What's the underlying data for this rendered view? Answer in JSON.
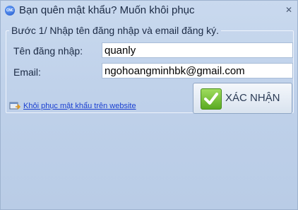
{
  "window": {
    "title": "Bạn quên mật khẩu? Muốn khôi phục",
    "icon": "app-logo-icon",
    "icon_text": "CNC",
    "close_glyph": "✕"
  },
  "group": {
    "legend": "Bước 1/ Nhập tên đăng nhập và email đăng ký."
  },
  "form": {
    "username_label": "Tên đăng nhập:",
    "username_value": "quanly",
    "email_label": "Email:",
    "email_value": "ngohoangminhbk@gmail.com"
  },
  "confirm_button": {
    "label": "XÁC NHẬN",
    "icon": "checkmark-icon"
  },
  "link": {
    "label": "Khôi phục mật khẩu trên website",
    "icon": "web-link-icon"
  },
  "colors": {
    "window_bg": "#bfd1ea",
    "link": "#1a3fd1",
    "check_green": "#5aaa22"
  }
}
